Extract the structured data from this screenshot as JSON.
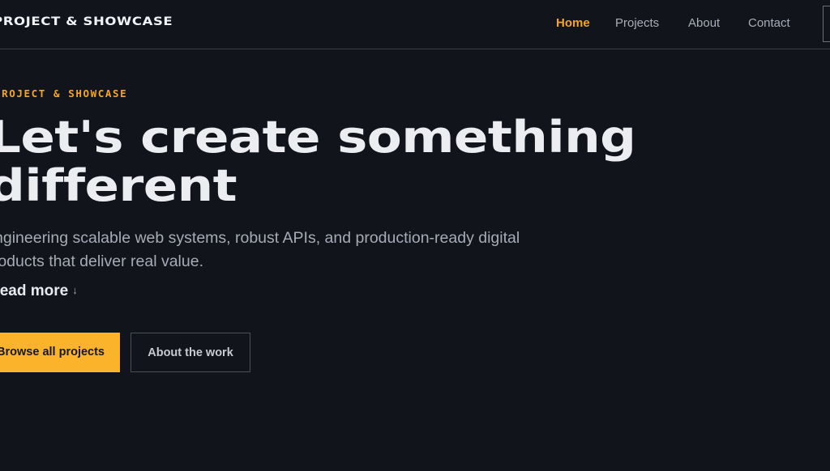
{
  "navbar": {
    "brand": "PROJECT & SHOWCASE",
    "links": [
      {
        "label": "Home",
        "active": true
      },
      {
        "label": "Projects",
        "active": false
      },
      {
        "label": "About",
        "active": false
      },
      {
        "label": "Contact",
        "active": false
      }
    ]
  },
  "hero": {
    "eyebrow": "PROJECT & SHOWCASE",
    "headline_line1": "Let's create something",
    "headline_line2": "different",
    "lede": "Engineering scalable web systems, robust APIs, and production-ready digital products that deliver real value.",
    "read_more": "Read more",
    "read_more_arrow": "↓",
    "primary_button": "Browse all projects",
    "secondary_button": "About the work"
  },
  "colors": {
    "background": "#12141c",
    "accent": "#f5a524",
    "button_primary": "#fbb32b",
    "text": "#ecedf1",
    "muted": "#a7abb6"
  }
}
